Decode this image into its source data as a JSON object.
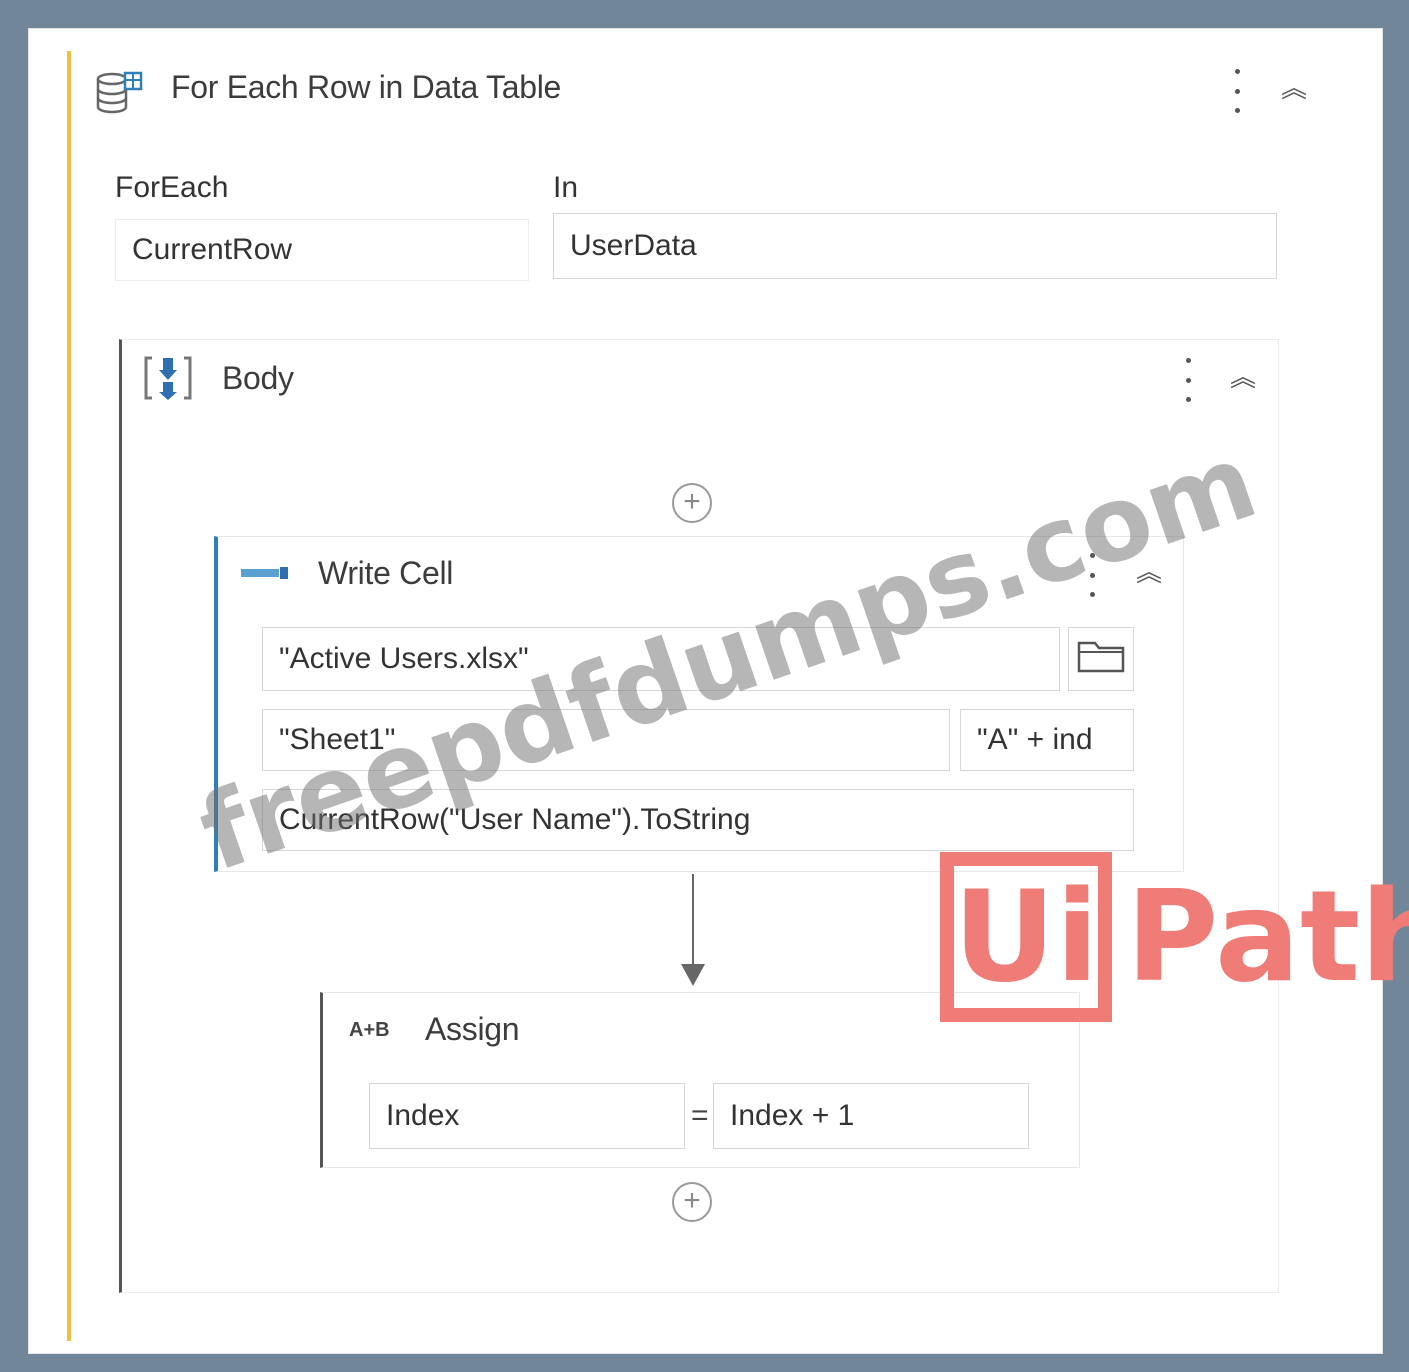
{
  "foreach": {
    "title": "For Each Row in Data Table",
    "icon": "data-table-icon",
    "foreach_label": "ForEach",
    "foreach_value": "CurrentRow",
    "in_label": "In",
    "in_value": "UserData"
  },
  "body": {
    "title": "Body",
    "icon": "sequence-icon"
  },
  "write_cell": {
    "title": "Write Cell",
    "icon": "write-cell-icon",
    "workbook_path": "\"Active Users.xlsx\"",
    "sheet_name": "\"Sheet1\"",
    "range": "\"A\" + ind",
    "value": "CurrentRow(\"User Name\").ToString"
  },
  "assign": {
    "title": "Assign",
    "icon_text": "A+B",
    "to": "Index",
    "operator": "=",
    "value": "Index + 1"
  },
  "controls": {
    "add_symbol": "+",
    "collapse_symbol": "︽"
  },
  "watermark": {
    "text": "freepdfdumps.com"
  },
  "logo": {
    "box_text": "Ui",
    "text": "Path",
    "color": "#f07c78"
  },
  "colors": {
    "accent_foreach": "#f0c040",
    "accent_write_cell": "#2f7fb8",
    "accent_assign": "#555555",
    "background": "#72869a"
  }
}
